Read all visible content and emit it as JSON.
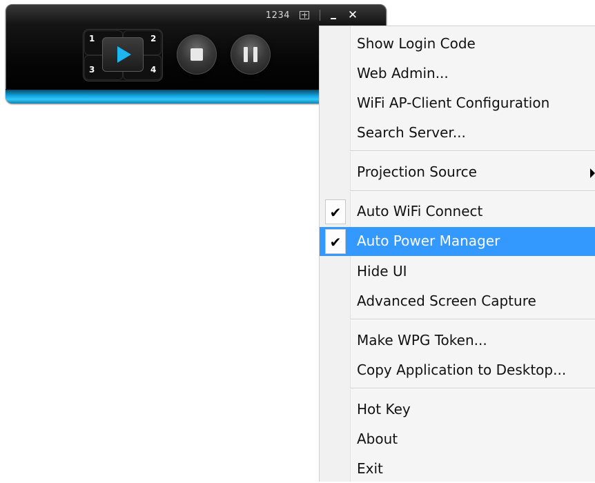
{
  "player": {
    "status_code": "1234",
    "quadrant_labels": [
      "1",
      "2",
      "3",
      "4"
    ],
    "icons": {
      "layout": "layout-grid-icon",
      "minimize": "minimize-icon",
      "close": "close-icon",
      "play": "play-icon",
      "stop": "stop-icon",
      "pause": "pause-icon"
    },
    "minimize_glyph": "",
    "close_glyph": "✕",
    "accent_color": "#1db6f0"
  },
  "menu": {
    "highlight_color": "#3399ff",
    "items": [
      {
        "label": "Show Login Code"
      },
      {
        "label": "Web Admin..."
      },
      {
        "label": "WiFi AP-Client Configuration"
      },
      {
        "label": "Search Server..."
      },
      {
        "label": "Projection Source",
        "submenu": true
      },
      {
        "label": "Auto WiFi Connect",
        "checked": true
      },
      {
        "label": "Auto Power Manager",
        "checked": true,
        "highlighted": true
      },
      {
        "label": "Hide UI"
      },
      {
        "label": "Advanced Screen Capture"
      },
      {
        "label": "Make WPG Token..."
      },
      {
        "label": "Copy Application to Desktop..."
      },
      {
        "label": "Hot Key"
      },
      {
        "label": "About"
      },
      {
        "label": "Exit"
      }
    ],
    "check_glyph": "✔"
  }
}
